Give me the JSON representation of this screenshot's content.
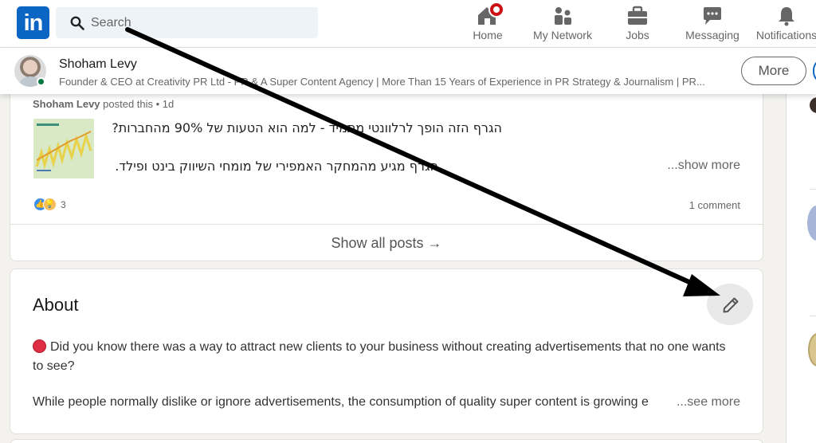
{
  "nav": {
    "logo_text": "in",
    "search_placeholder": "Search",
    "items": [
      {
        "label": "Home",
        "icon": "home-icon"
      },
      {
        "label": "My Network",
        "icon": "network-icon"
      },
      {
        "label": "Jobs",
        "icon": "briefcase-icon"
      },
      {
        "label": "Messaging",
        "icon": "messaging-icon"
      },
      {
        "label": "Notifications",
        "icon": "bell-icon"
      }
    ]
  },
  "profile_header": {
    "name": "Shoham Levy",
    "headline": "Founder & CEO at Creativity PR Ltd - PR & A Super Content Agency | More Than 15 Years of Experience in PR Strategy & Journalism | PR...",
    "more_label": "More"
  },
  "activity": {
    "poster_name": "Shoham Levy",
    "posted_meta": "posted this • 1d",
    "post_line1": "הגרף הזה הופך לרלוונטי מתמיד - למה הוא הטעות של 90% מהחברות?",
    "post_line2": "הגרף מגיע מהמחקר האמפירי של מומחי השיווק בינט ופילד.",
    "show_more": "...show more",
    "reaction_count": "3",
    "comments": "1 comment",
    "show_all_posts": "Show all posts →"
  },
  "about": {
    "title": "About",
    "paragraph1": "Did you know there was a way to attract new clients to your business without creating advertisements that no one wants to see?",
    "paragraph2": "While people normally dislike or ignore advertisements, the consumption of quality super content is growing e",
    "see_more": "...see more"
  },
  "colors": {
    "brand": "#0a66c2",
    "notification_badge": "#cc1016",
    "online": "#057642"
  }
}
